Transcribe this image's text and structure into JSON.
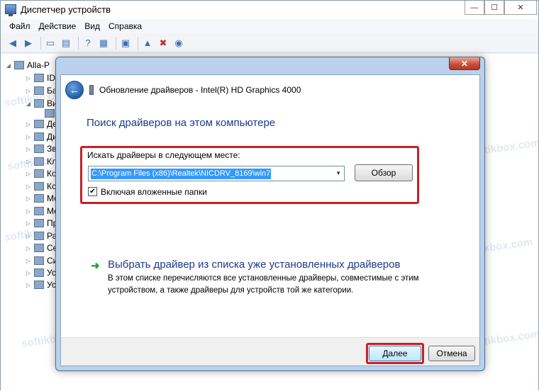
{
  "window": {
    "title": "Диспетчер устройств",
    "controls": {
      "minimize": "—",
      "maximize": "☐",
      "close": "✕"
    }
  },
  "menu": [
    "Файл",
    "Действие",
    "Вид",
    "Справка"
  ],
  "tree": {
    "root": "Alla-P",
    "items": [
      "ID",
      "Ба",
      "Ви",
      "Де",
      "Ди",
      "Зв",
      "Кл",
      "Ко",
      "Ко",
      "Мо",
      "Мо",
      "Пр",
      "Ра",
      "Се",
      "Си",
      "Ус",
      "Ус"
    ]
  },
  "watermark": "softikbox.com",
  "dialog": {
    "title": "Обновление драйверов - Intel(R) HD Graphics 4000",
    "close": "✕",
    "section_title": "Поиск драйверов на этом компьютере",
    "search_label": "Искать драйверы в следующем месте:",
    "path_value": "C:\\Program Files (x86)\\Realtek\\NICDRV_8169\\win7",
    "browse_label": "Обзор",
    "include_subfolders_label": "Включая вложенные папки",
    "include_subfolders_checked": "✔",
    "option_title": "Выбрать драйвер из списка уже установленных драйверов",
    "option_desc": "В этом списке перечисляются все установленные драйверы, совместимые с этим устройством, а также драйверы для устройств той же категории.",
    "next_label": "Далее",
    "cancel_label": "Отмена"
  },
  "colors": {
    "highlight": "#c8202b",
    "heading": "#1e3a8a",
    "selection": "#3399ff"
  }
}
